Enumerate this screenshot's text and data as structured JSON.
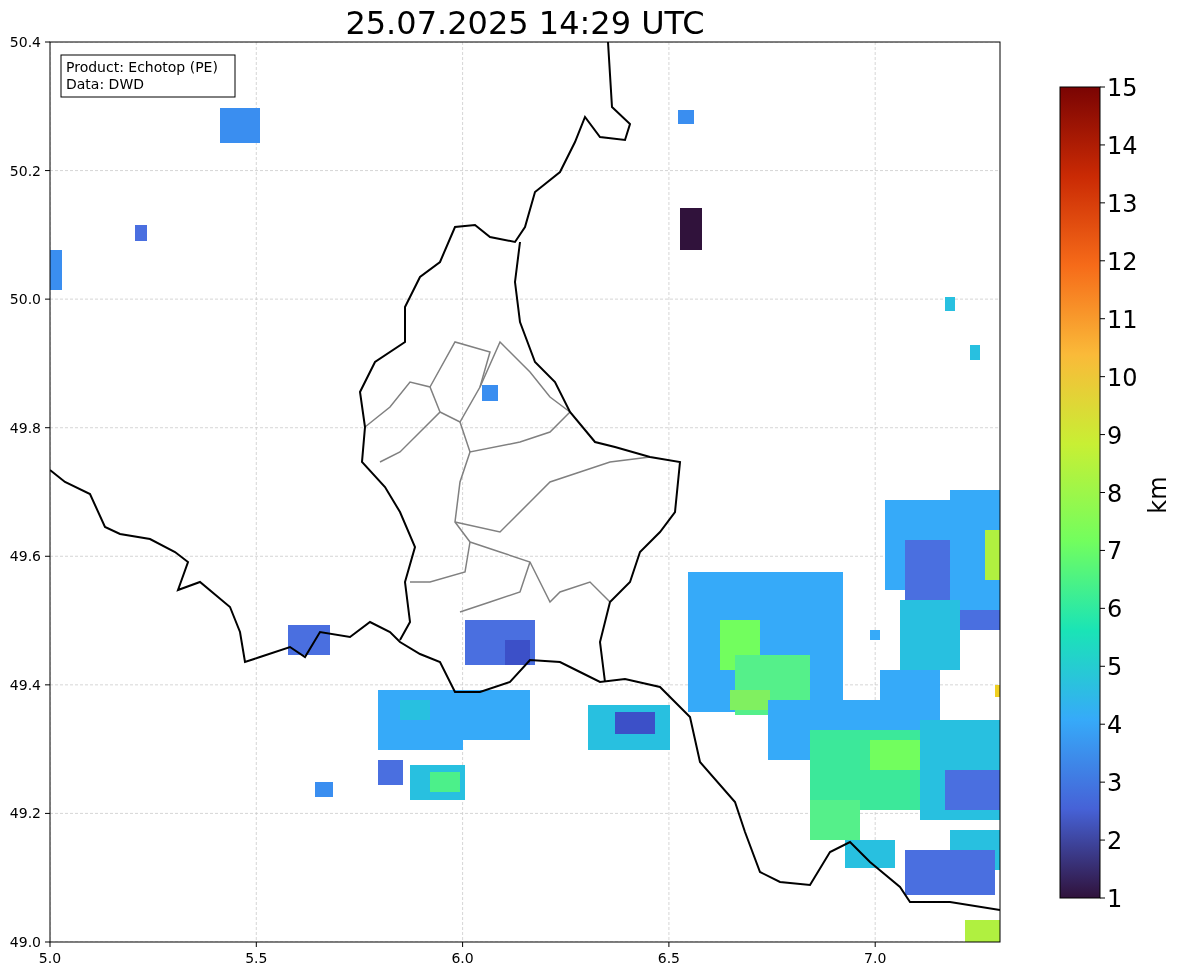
{
  "title": "25.07.2025 14:29 UTC",
  "legend": [
    "Product: Echotop (PE)",
    "Data: DWD"
  ],
  "x_ticks": [
    "5.0",
    "5.5",
    "6.0",
    "6.5",
    "7.0"
  ],
  "y_ticks": [
    "50.4",
    "50.2",
    "50.0",
    "49.8",
    "49.6",
    "49.4",
    "49.2",
    "49.0"
  ],
  "colorbar": {
    "label": "km",
    "ticks": [
      "15",
      "14",
      "13",
      "12",
      "11",
      "10",
      "9",
      "8",
      "7",
      "6",
      "5",
      "4",
      "3",
      "2",
      "1"
    ]
  }
}
